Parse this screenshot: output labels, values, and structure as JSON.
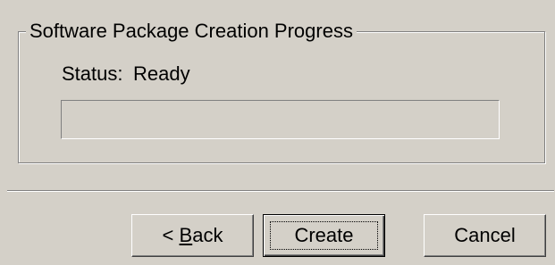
{
  "group": {
    "title": "Software Package Creation Progress"
  },
  "status": {
    "label": "Status:",
    "value": "Ready"
  },
  "progress": {
    "fraction": 0
  },
  "buttons": {
    "back_prefix": "< ",
    "back_accel": "B",
    "back_suffix": "ack",
    "create_label": "Create",
    "cancel_label": "Cancel"
  }
}
